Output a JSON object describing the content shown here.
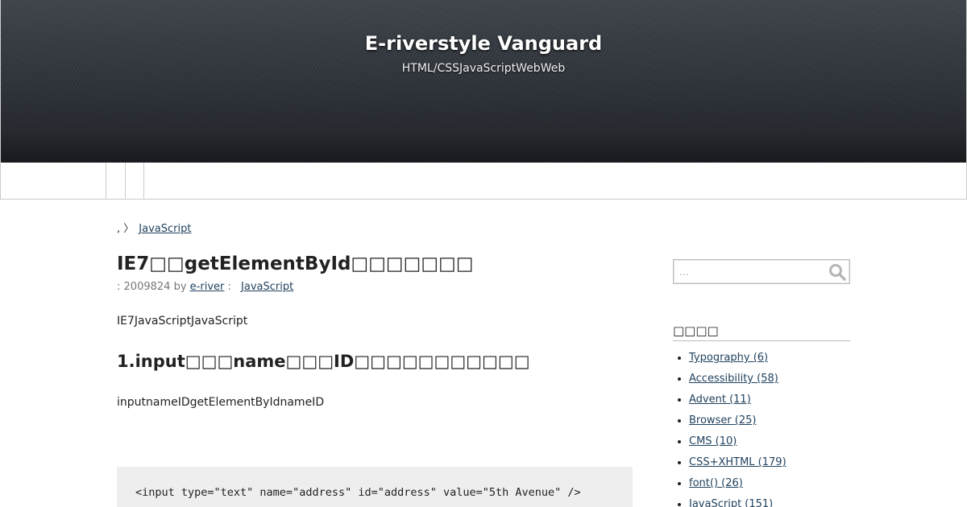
{
  "site": {
    "title": "E-riverstyle Vanguard",
    "description": "HTML/CSSJavaScriptWebWeb"
  },
  "breadcrumb": {
    "prefix": ", 〉",
    "category": "JavaScript"
  },
  "post": {
    "title": "IE7□□getElementById□□□□□□□",
    "meta": {
      "date_prefix": ":",
      "date": "2009824",
      "by": "by",
      "author": "e-river",
      "category_prefix": ":",
      "category": "JavaScript"
    },
    "intro": "IE7JavaScriptJavaScript",
    "section_heading": "1.input□□□name□□□ID□□□□□□□□□□□",
    "paragraph": "inputnameIDgetElementByIdnameID",
    "code": "<input type=\"text\" name=\"address\" id=\"address\" value=\"5th Avenue\" />"
  },
  "sidebar": {
    "search": {
      "placeholder": "…",
      "icon": "search-icon"
    },
    "categories_title": "□□□□",
    "categories": [
      {
        "label": "Typography (6)"
      },
      {
        "label": "Accessibility (58)"
      },
      {
        "label": "Advent (11)"
      },
      {
        "label": "Browser (25)"
      },
      {
        "label": "CMS (10)"
      },
      {
        "label": "CSS+XHTML (179)"
      },
      {
        "label": "font() (26)"
      },
      {
        "label": "JavaScript (151)"
      }
    ]
  },
  "colors": {
    "link": "#21425e",
    "header_dark": "#1e2126",
    "code_bg": "#eeeeee"
  }
}
